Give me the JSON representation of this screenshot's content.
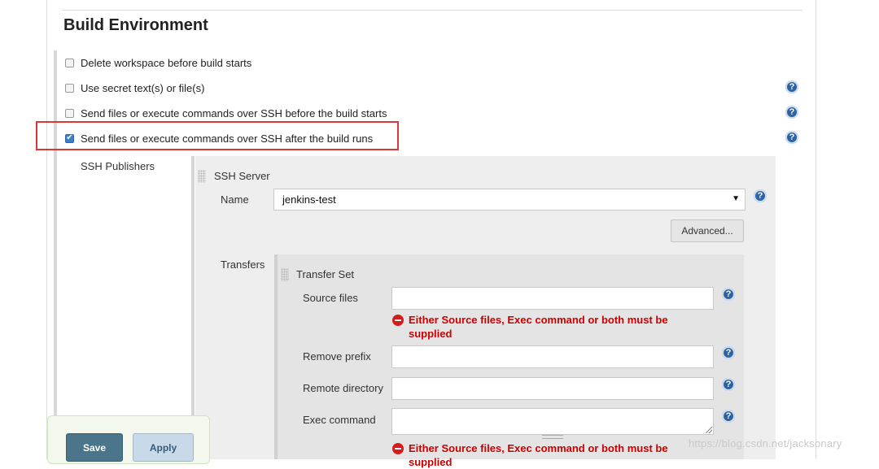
{
  "section": {
    "title": "Build Environment"
  },
  "options": [
    {
      "label": "Delete workspace before build starts",
      "checked": false
    },
    {
      "label": "Use secret text(s) or file(s)",
      "checked": false
    },
    {
      "label": "Send files or execute commands over SSH before the build starts",
      "checked": false
    },
    {
      "label": "Send files or execute commands over SSH after the build runs",
      "checked": true
    }
  ],
  "help_glyph": "?",
  "check_glyph": "✔",
  "ssh": {
    "publishers_label": "SSH Publishers",
    "server_title": "SSH Server",
    "name_label": "Name",
    "name_value": "jenkins-test",
    "dropdown_arrow": "▼",
    "advanced_label": "Advanced...",
    "transfers_label": "Transfers",
    "transfer_set_title": "Transfer Set",
    "source_files_label": "Source files",
    "remove_prefix_label": "Remove prefix",
    "remote_directory_label": "Remote directory",
    "exec_command_label": "Exec command",
    "error_message": "Either Source files, Exec command or both must be supplied"
  },
  "buttons": {
    "save": "Save",
    "apply": "Apply"
  },
  "colors": {
    "highlight": "#e23434",
    "error": "#cc0000",
    "help": "#2d62a3",
    "save": "#4b758b"
  },
  "watermark": "https://blog.csdn.net/jacksonary"
}
